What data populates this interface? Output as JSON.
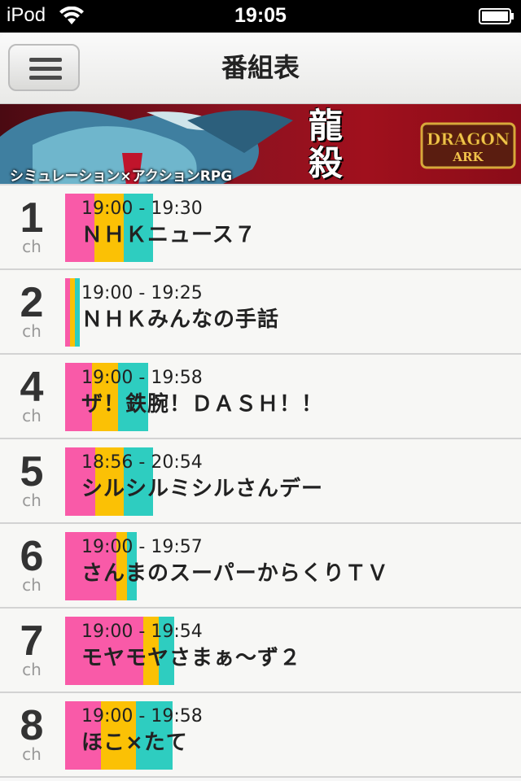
{
  "status_bar": {
    "carrier": "iPod",
    "time": "19:05"
  },
  "nav": {
    "title": "番組表"
  },
  "ad": {
    "tagline": "シミュレーション×アクションRPG",
    "kanji_1": "龍",
    "kanji_2": "殺",
    "logo_line1": "DRAGON",
    "logo_line2": "ARK"
  },
  "colors": {
    "pink": "#f95aa8",
    "yellow": "#fbc105",
    "teal": "#2ecdc0"
  },
  "programs": [
    {
      "channel": "1",
      "ch_label": "ch",
      "time": "19:00 - 19:30",
      "title": "ＮＨＫニュース７",
      "progress": [
        0.33,
        0.34,
        0.33
      ]
    },
    {
      "channel": "2",
      "ch_label": "ch",
      "time": "19:00 - 19:25",
      "title": "ＮＨＫみんなの手話",
      "progress": [
        0.34,
        0.33,
        0.33
      ]
    },
    {
      "channel": "4",
      "ch_label": "ch",
      "time": "19:00 - 19:58",
      "title": "ザ！鉄腕！ＤＡＳＨ！！",
      "progress": [
        0.32,
        0.32,
        0.36
      ]
    },
    {
      "channel": "5",
      "ch_label": "ch",
      "time": "18:56 - 20:54",
      "title": "シルシルミシルさんデー",
      "progress": [
        0.34,
        0.33,
        0.33
      ]
    },
    {
      "channel": "6",
      "ch_label": "ch",
      "time": "19:00 - 19:57",
      "title": "さんまのスーパーからくりＴＶ",
      "progress": [
        0.72,
        0.14,
        0.14
      ]
    },
    {
      "channel": "7",
      "ch_label": "ch",
      "time": "19:00 - 19:54",
      "title": "モヤモヤさまぁ～ず２",
      "progress": [
        0.72,
        0.14,
        0.14
      ]
    },
    {
      "channel": "8",
      "ch_label": "ch",
      "time": "19:00 - 19:58",
      "title": "ほこ×たて",
      "progress": [
        0.33,
        0.33,
        0.34
      ]
    }
  ]
}
